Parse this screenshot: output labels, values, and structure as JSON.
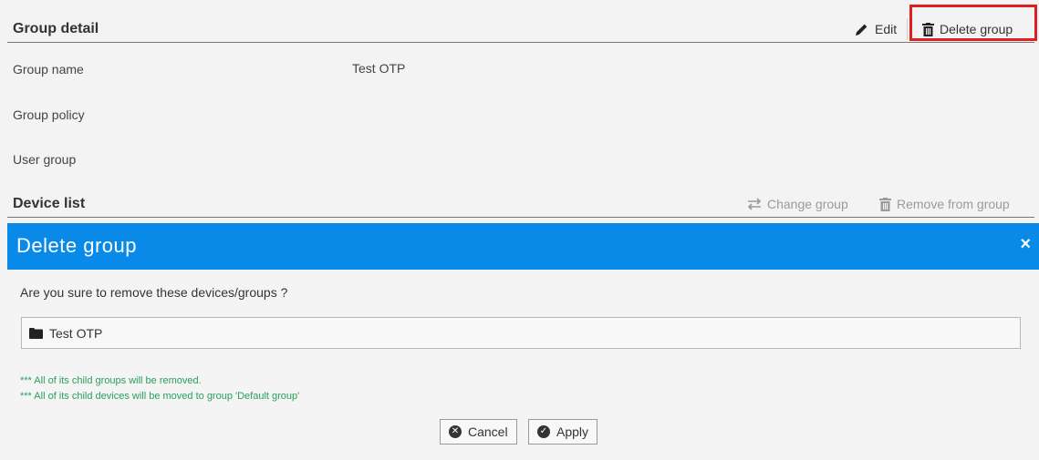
{
  "group_detail": {
    "title": "Group detail",
    "edit_label": "Edit",
    "delete_label": "Delete group",
    "rows": [
      {
        "label": "Group name",
        "value": "Test OTP"
      },
      {
        "label": "Group policy",
        "value": ""
      },
      {
        "label": "User group",
        "value": ""
      }
    ]
  },
  "device_list": {
    "title": "Device list",
    "change_group_label": "Change group",
    "remove_from_group_label": "Remove from group"
  },
  "dialog": {
    "title": "Delete group",
    "close_symbol": "×",
    "confirm_text": "Are you sure to remove these devices/groups ?",
    "items": [
      "Test OTP"
    ],
    "notes": [
      "*** All of its child groups will be removed.",
      "*** All of its child devices will be moved to group 'Default group'"
    ],
    "cancel_label": "Cancel",
    "apply_label": "Apply"
  },
  "colors": {
    "dialog_header": "#0a8ae8",
    "note_text": "#27a05a",
    "highlight": "#e02020"
  }
}
